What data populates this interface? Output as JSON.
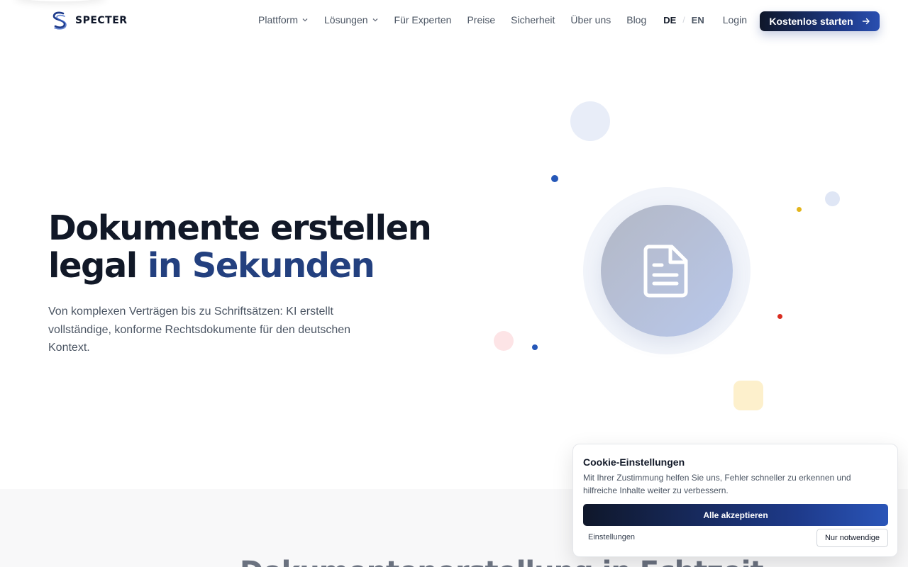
{
  "brand": {
    "name": "SPECTER"
  },
  "nav": {
    "items": [
      {
        "label": "Plattform",
        "dropdown": true
      },
      {
        "label": "Lösungen",
        "dropdown": true
      },
      {
        "label": "Für Experten",
        "dropdown": false
      },
      {
        "label": "Preise",
        "dropdown": false
      },
      {
        "label": "Sicherheit",
        "dropdown": false
      },
      {
        "label": "Über uns",
        "dropdown": false
      },
      {
        "label": "Blog",
        "dropdown": false
      }
    ],
    "lang_de": "DE",
    "lang_separator": "/",
    "lang_en": "EN",
    "login": "Login",
    "cta": "Kostenlos starten"
  },
  "hero": {
    "title_line1": "Dokumente erstellen",
    "title_line2_plain": "legal ",
    "title_line2_accent": "in Sekunden",
    "subtitle": "Von komplexen Verträgen bis zu Schriftsätzen: KI erstellt vollständige, konforme Rechtsdokumente für den deutschen Kontext.",
    "icon": "document-icon"
  },
  "section2": {
    "title": "Dokumentenerstellung in Echtzeit"
  },
  "cookie": {
    "title": "Cookie-Einstellungen",
    "text": "Mit Ihrer Zustimmung helfen Sie uns, Fehler schneller zu erkennen und hilfreiche Inhalte weiter zu verbessern.",
    "accept": "Alle akzeptieren",
    "settings": "Einstellungen",
    "necessary": "Nur notwendige"
  },
  "colors": {
    "brand_navy": "#0f172a",
    "accent_blue": "#23407f",
    "dot_blue": "#2557b8",
    "dot_red": "#d92d20",
    "dot_yellow": "#e3b51c"
  }
}
